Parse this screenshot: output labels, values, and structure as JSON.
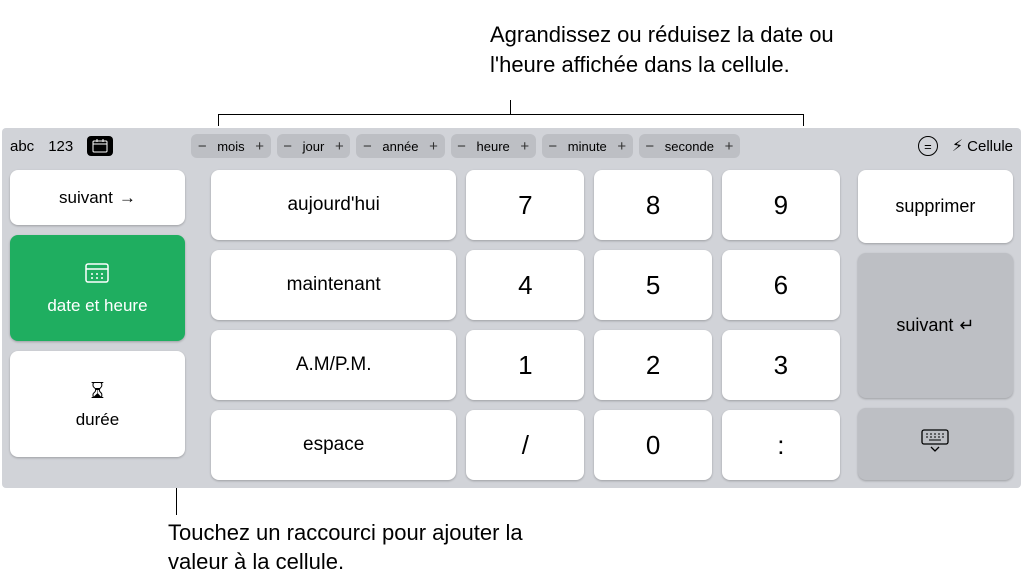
{
  "annotations": {
    "top": "Agrandissez ou réduisez la date ou l'heure affichée dans la cellule.",
    "bottom": "Touchez un raccourci pour ajouter la valeur à la cellule."
  },
  "topbar": {
    "tabs": {
      "abc": "abc",
      "123": "123"
    },
    "steppers": {
      "mois": "mois",
      "jour": "jour",
      "annee": "année",
      "heure": "heure",
      "minute": "minute",
      "seconde": "seconde",
      "minus": "−",
      "plus": "+"
    },
    "equals": "=",
    "cellule": "Cellule"
  },
  "left": {
    "suivant": "suivant",
    "date_heure": "date et heure",
    "duree": "durée"
  },
  "shortcuts": {
    "aujourdhui": "aujourd'hui",
    "maintenant": "maintenant",
    "ampm": "A.M/P.M.",
    "espace": "espace"
  },
  "numpad": {
    "k7": "7",
    "k8": "8",
    "k9": "9",
    "k4": "4",
    "k5": "5",
    "k6": "6",
    "k1": "1",
    "k2": "2",
    "k3": "3",
    "slash": "/",
    "k0": "0",
    "colon": ":"
  },
  "right": {
    "supprimer": "supprimer",
    "suivant": "suivant"
  }
}
